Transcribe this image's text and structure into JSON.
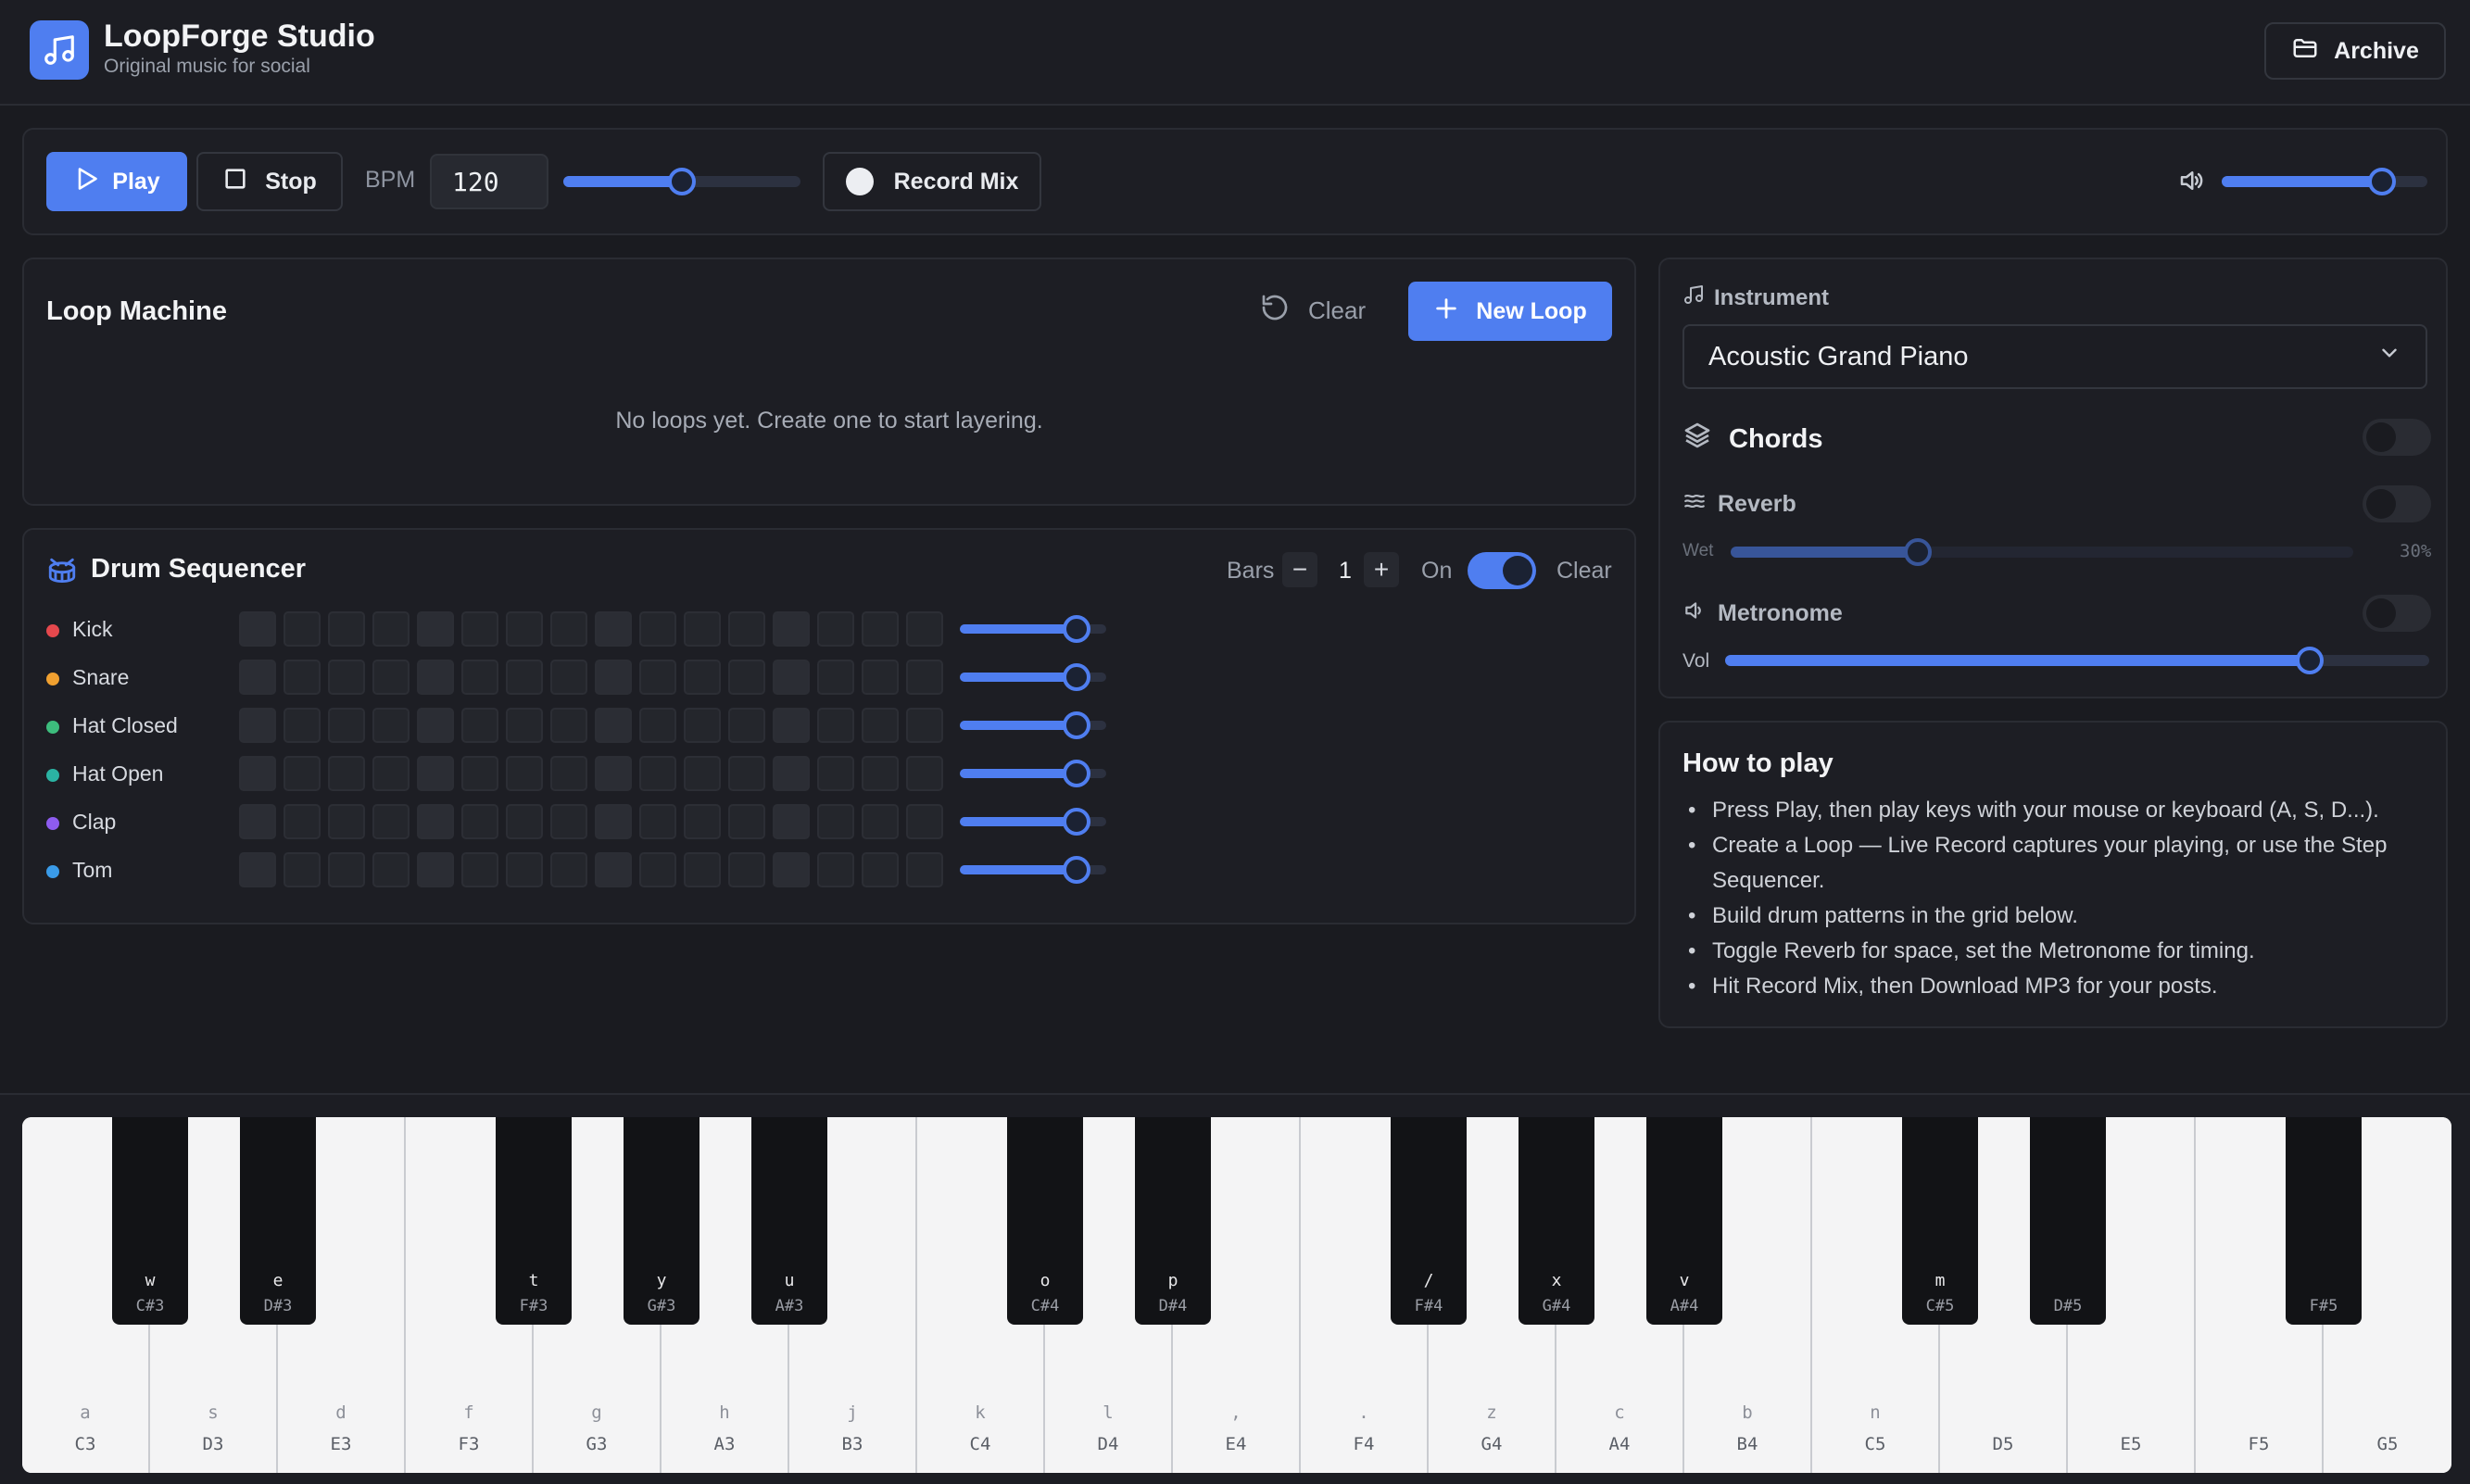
{
  "header": {
    "title": "LoopForge Studio",
    "subtitle": "Original music for social",
    "archive_label": "Archive"
  },
  "transport": {
    "play_label": "Play",
    "stop_label": "Stop",
    "bpm_label": "BPM",
    "bpm_value": "120",
    "bpm_slider_fraction": 0.5,
    "record_label": "Record Mix",
    "master_volume_fraction": 0.78
  },
  "loop_machine": {
    "title": "Loop Machine",
    "clear_label": "Clear",
    "new_loop_label": "New Loop",
    "empty_text": "No loops yet. Create one to start layering."
  },
  "drum_sequencer": {
    "title": "Drum Sequencer",
    "bars_label": "Bars",
    "bars_value": "1",
    "minus_glyph": "−",
    "plus_glyph": "+",
    "on_label": "On",
    "enabled": true,
    "clear_label": "Clear",
    "tracks": [
      {
        "name": "Kick",
        "color": "#e5484d",
        "volume_fraction": 0.8
      },
      {
        "name": "Snare",
        "color": "#f0a030",
        "volume_fraction": 0.8
      },
      {
        "name": "Hat Closed",
        "color": "#3dbd7d",
        "volume_fraction": 0.8
      },
      {
        "name": "Hat Open",
        "color": "#2bb3a3",
        "volume_fraction": 0.8
      },
      {
        "name": "Clap",
        "color": "#8e5cf0",
        "volume_fraction": 0.8
      },
      {
        "name": "Tom",
        "color": "#3a9be8",
        "volume_fraction": 0.8
      }
    ]
  },
  "instrument": {
    "label": "Instrument",
    "selected": "Acoustic Grand Piano",
    "chords_label": "Chords",
    "chords_on": false,
    "reverb_label": "Reverb",
    "reverb_on": false,
    "wet_label": "Wet",
    "wet_value": "30%",
    "wet_fraction": 0.3,
    "metronome_label": "Metronome",
    "metronome_on": false,
    "vol_label": "Vol",
    "vol_fraction": 0.83
  },
  "howto": {
    "title": "How to play",
    "items": [
      "Press Play, then play keys with your mouse or keyboard (A, S, D...).",
      "Create a Loop — Live Record captures your playing, or use the Step Sequencer.",
      "Build drum patterns in the grid below.",
      "Toggle Reverb for space, set the Metronome for timing.",
      "Hit Record Mix, then Download MP3 for your posts."
    ]
  },
  "piano": {
    "white_keys": [
      {
        "key": "a",
        "note": "C3"
      },
      {
        "key": "s",
        "note": "D3"
      },
      {
        "key": "d",
        "note": "E3"
      },
      {
        "key": "f",
        "note": "F3"
      },
      {
        "key": "g",
        "note": "G3"
      },
      {
        "key": "h",
        "note": "A3"
      },
      {
        "key": "j",
        "note": "B3"
      },
      {
        "key": "k",
        "note": "C4"
      },
      {
        "key": "l",
        "note": "D4"
      },
      {
        "key": ",",
        "note": "E4"
      },
      {
        "key": ".",
        "note": "F4"
      },
      {
        "key": "z",
        "note": "G4"
      },
      {
        "key": "c",
        "note": "A4"
      },
      {
        "key": "b",
        "note": "B4"
      },
      {
        "key": "n",
        "note": "C5"
      },
      {
        "key": "",
        "note": "D5"
      },
      {
        "key": "",
        "note": "E5"
      },
      {
        "key": "",
        "note": "F5"
      },
      {
        "key": "",
        "note": "G5"
      }
    ],
    "black_keys": [
      {
        "key": "w",
        "note": "C#3",
        "after": 0
      },
      {
        "key": "e",
        "note": "D#3",
        "after": 1
      },
      {
        "key": "t",
        "note": "F#3",
        "after": 3
      },
      {
        "key": "y",
        "note": "G#3",
        "after": 4
      },
      {
        "key": "u",
        "note": "A#3",
        "after": 5
      },
      {
        "key": "o",
        "note": "C#4",
        "after": 7
      },
      {
        "key": "p",
        "note": "D#4",
        "after": 8
      },
      {
        "key": "/",
        "note": "F#4",
        "after": 10
      },
      {
        "key": "x",
        "note": "G#4",
        "after": 11
      },
      {
        "key": "v",
        "note": "A#4",
        "after": 12
      },
      {
        "key": "m",
        "note": "C#5",
        "after": 14
      },
      {
        "key": "",
        "note": "D#5",
        "after": 15
      },
      {
        "key": "",
        "note": "F#5",
        "after": 17
      }
    ]
  },
  "colors": {
    "accent": "#4f7ef0",
    "background": "#1a1b20"
  }
}
